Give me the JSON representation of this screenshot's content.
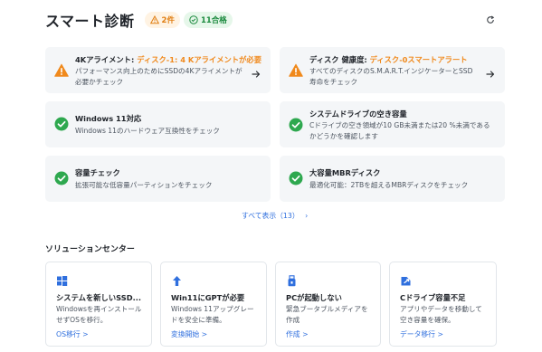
{
  "header": {
    "title": "スマート診断",
    "warning_badge": "2件",
    "ok_badge": "11合格"
  },
  "diagnostics": [
    {
      "status": "warning",
      "title": "4Kアライメント: ",
      "highlight": "ディスク-1: 4 Kアライメントが必要",
      "desc": "パフォーマンス向上のためにSSDの4Kアライメントが必要かチェック",
      "has_arrow": true
    },
    {
      "status": "warning",
      "title": "ディスク 健康度: ",
      "highlight": "ディスク-0スマートアラート",
      "desc": "すべてのディスクのS.M.A.R.T.インジケーターとSSD寿命をチェック",
      "has_arrow": true
    },
    {
      "status": "ok",
      "title": "Windows 11対応",
      "highlight": "",
      "desc": "Windows 11のハードウェア互換性をチェック",
      "has_arrow": false
    },
    {
      "status": "ok",
      "title": "システムドライブの空き容量",
      "highlight": "",
      "desc": "Cドライブの空き領域が10 GB未満または20 %未満であるかどうかを確認します",
      "has_arrow": false
    },
    {
      "status": "ok",
      "title": "容量チェック",
      "highlight": "",
      "desc": "拡張可能な低容量パーティションをチェック",
      "has_arrow": false
    },
    {
      "status": "ok",
      "title": "大容量MBRディスク",
      "highlight": "",
      "desc": "最適化可能：2TBを超えるMBRディスクをチェック",
      "has_arrow": false
    }
  ],
  "show_all": {
    "label": "すべて表示（13）",
    "chevron": "›"
  },
  "solutions": {
    "title": "ソリューションセンター",
    "items": [
      {
        "icon": "windows-icon",
        "title": "システムを新しいSSD...",
        "desc": "Windowsを再インストールせずOSを移行。",
        "link": "OS移行 >"
      },
      {
        "icon": "upload-arrow-icon",
        "title": "Win11にGPTが必要",
        "desc": "Windows 11アップグレードを安全に準備。",
        "link": "変換開始 >"
      },
      {
        "icon": "usb-drive-icon",
        "title": "PCが起動しない",
        "desc": "緊急ブータブルメディアを作成",
        "link": "作成 >"
      },
      {
        "icon": "data-move-icon",
        "title": "Cドライブ容量不足",
        "desc": "アプリやデータを移動して空き容量を確保。",
        "link": "データ移行 >"
      }
    ]
  },
  "colors": {
    "warning": "#f0891c",
    "ok": "#2ea84f",
    "link": "#2f6fde",
    "card_bg": "#f4f6f8"
  }
}
